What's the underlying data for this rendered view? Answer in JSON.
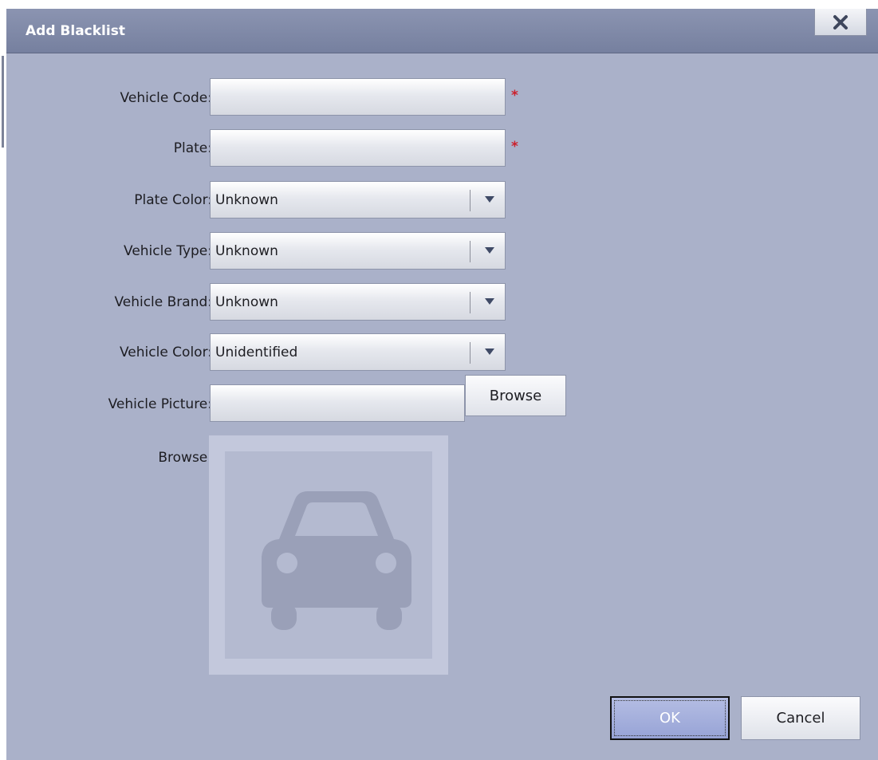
{
  "dialog": {
    "title": "Add Blacklist",
    "close_icon": "close-icon"
  },
  "form": {
    "vehicle_code_label": "Vehicle Code:",
    "vehicle_code_value": "",
    "vehicle_code_required": "*",
    "plate_label": "Plate:",
    "plate_value": "",
    "plate_required": "*",
    "plate_color_label": "Plate Color:",
    "plate_color_value": "Unknown",
    "vehicle_type_label": "Vehicle Type:",
    "vehicle_type_value": "Unknown",
    "vehicle_brand_label": "Vehicle Brand:",
    "vehicle_brand_value": "Unknown",
    "vehicle_color_label": "Vehicle Color:",
    "vehicle_color_value": "Unidentified",
    "vehicle_picture_label": "Vehicle Picture:",
    "vehicle_picture_value": "",
    "browse_button": "Browse",
    "preview_label": "Browse:",
    "preview_icon": "car-placeholder-icon"
  },
  "footer": {
    "ok_label": "OK",
    "cancel_label": "Cancel"
  },
  "colors": {
    "dialog_bg": "#aab1c9",
    "titlebar": "#7f89a7",
    "required": "#cc1f2b",
    "ok_button": "#a3aedc"
  }
}
